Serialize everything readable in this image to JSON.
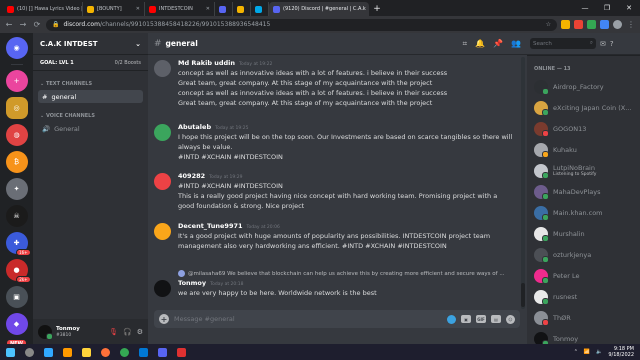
{
  "browser": {
    "tabs": [
      {
        "title": "(10) [] Hawa Lyrics Video | H",
        "color": "#ff0000"
      },
      {
        "title": "[BOUNTY]",
        "color": "#f4b400"
      },
      {
        "title": "INTDESTCOIN",
        "color": "#ff0000"
      },
      {
        "title": "",
        "color": "#5865f2"
      },
      {
        "title": "",
        "color": "#f4b400"
      },
      {
        "title": "",
        "color": "#00a8e8"
      },
      {
        "title": "(9120) Discord | #general | C.A.k",
        "color": "#5865f2"
      }
    ],
    "url_host": "discord.com",
    "url_path": "/channels/991015388458418226/991015388936548415"
  },
  "server_list": {
    "badges": [
      "16+",
      "2k+"
    ],
    "new_label": "NEW"
  },
  "sidebar": {
    "server_name": "C.A.K INTDEST",
    "goal_label": "GOAL: LVL 1",
    "boosts": "0/2 Boosts",
    "text_channels_label": "TEXT CHANNELS",
    "voice_channels_label": "VOICE CHANNELS",
    "text_channels": [
      "general"
    ],
    "voice_channels": [
      "General"
    ]
  },
  "user": {
    "name": "Tonmoy",
    "tag": "#3810"
  },
  "channel": {
    "name": "general"
  },
  "search": {
    "placeholder": "Search"
  },
  "messages": [
    {
      "author": "Md Rakib uddin",
      "time": "Today at 19:22",
      "color": "#b9bbbe",
      "avatar": "#5d6068",
      "lines": [
        "concept as well as innovative ideas with a lot of features. i believe in their success",
        "Great team, great company. At this stage of my acquaintance with the project",
        "concept as well as innovative ideas with a lot of features. i believe in their success",
        "Great team, great company. At this stage of my acquaintance with the project"
      ]
    },
    {
      "author": "Abutaleb",
      "time": "Today at 19:25",
      "color": "#3ba55d",
      "avatar": "#3ba55d",
      "lines": [
        "I hope this project will be on the top soon. Our Investments are based on scarce tangibles so there will",
        "always be value.",
        "#INTD #XCHAIN #INTDESTCOIN"
      ]
    },
    {
      "author": "409282",
      "time": "Today at 19:29",
      "color": "#ed4245",
      "avatar": "#ed4245",
      "lines": [
        "#INTD #XCHAIN #INTDESTCOIN",
        "This is a really good project having nice concept with hard working team. Promising project with a",
        "good foundation & strong. Nice project"
      ]
    },
    {
      "author": "Decent_Tune9971",
      "time": "Today at 20:06",
      "color": "#faa61a",
      "avatar": "#faa61a",
      "lines": [
        "It's a good project with huge amounts of popularity ans possibilities. INTDESTCOIN project team",
        "management also very hardworking ans efficient. #INTD #XCHAIN #INTDESTCOIN"
      ]
    },
    {
      "author": "Tonmoy",
      "time": "Today at 20:18",
      "color": "#202225",
      "avatar": "#111214",
      "reply": "@milasaha69 We believe that blockchain can help us achieve this by creating more efficient and secure ways of ...",
      "lines": [
        "we are very happy to be here. Worldwide network is the best"
      ]
    }
  ],
  "composer": {
    "placeholder": "Message #general",
    "gif_label": "GIF"
  },
  "members": {
    "header": "ONLINE — 13",
    "list": [
      {
        "name": "Airdrop_Factory",
        "sub": "",
        "avatar": "#2c2f33",
        "status": "#3ba55d"
      },
      {
        "name": "eXciting Japan Coin (X...",
        "sub": "",
        "avatar": "#d9a441",
        "status": "#3ba55d"
      },
      {
        "name": "GOGON13",
        "sub": "",
        "avatar": "#7a3b2e",
        "status": "#ed4245"
      },
      {
        "name": "Kuhaku",
        "sub": "",
        "avatar": "#a6a8ad",
        "status": "#faa61a"
      },
      {
        "name": "LutpiNoBrain",
        "sub": "Listening to Spotify",
        "avatar": "#c3c6cc",
        "status": "#3ba55d"
      },
      {
        "name": "MahaDevPlays",
        "sub": "",
        "avatar": "#6d5c8c",
        "status": "#3ba55d"
      },
      {
        "name": "Main.khan.com",
        "sub": "",
        "avatar": "#3a6ea5",
        "status": "#3ba55d"
      },
      {
        "name": "Murshalin",
        "sub": "",
        "avatar": "#e6e6e6",
        "status": "#3ba55d"
      },
      {
        "name": "ozturkjenya",
        "sub": "",
        "avatar": "#4c4f55",
        "status": "#3ba55d"
      },
      {
        "name": "Peter Le",
        "sub": "",
        "avatar": "#ee2b8d",
        "status": "#3ba55d"
      },
      {
        "name": "rusnest",
        "sub": "",
        "avatar": "#e9e9e9",
        "status": "#3ba55d"
      },
      {
        "name": "ThØR",
        "sub": "",
        "avatar": "#8b8f96",
        "status": "#ed4245"
      },
      {
        "name": "Tonmoy",
        "sub": "",
        "avatar": "#111214",
        "status": "#3ba55d"
      }
    ]
  },
  "taskbar": {
    "time": "9:18 PM",
    "date": "9/18/2022"
  }
}
